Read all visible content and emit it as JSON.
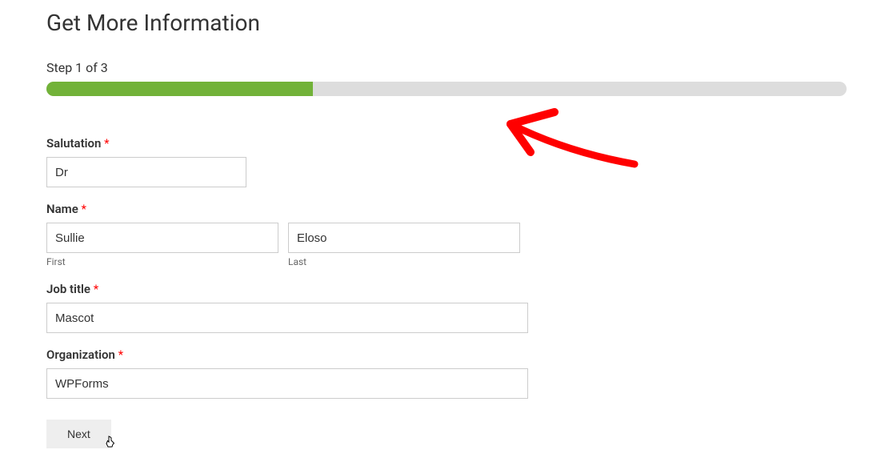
{
  "title": "Get More Information",
  "step_label": "Step 1 of 3",
  "progress_percent": 33.3,
  "fields": {
    "salutation": {
      "label": "Salutation",
      "required": "*",
      "value": "Dr"
    },
    "name": {
      "label": "Name",
      "required": "*",
      "first": {
        "value": "Sullie",
        "sublabel": "First"
      },
      "last": {
        "value": "Eloso",
        "sublabel": "Last"
      }
    },
    "job_title": {
      "label": "Job title",
      "required": "*",
      "value": "Mascot"
    },
    "organization": {
      "label": "Organization",
      "required": "*",
      "value": "WPForms"
    }
  },
  "buttons": {
    "next": "Next"
  }
}
